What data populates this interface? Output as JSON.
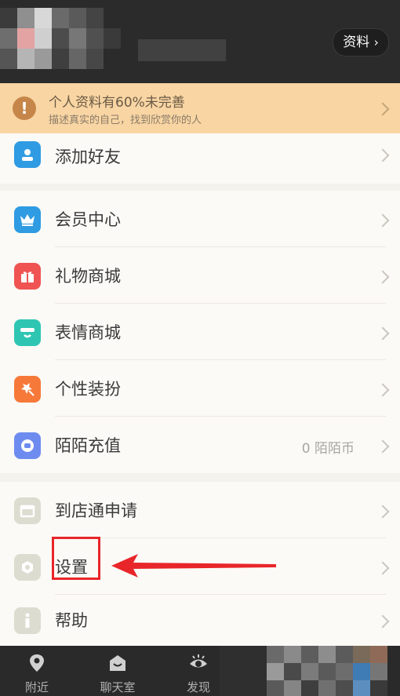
{
  "header": {
    "profile_button": "资料"
  },
  "banner": {
    "title": "个人资料有60%未完善",
    "subtitle": "描述真实的自己，找到欣赏你的人"
  },
  "menu": {
    "add_friend": "添加好友",
    "vip": "会员中心",
    "gift": "礼物商城",
    "emoji": "表情商城",
    "dressup": "个性装扮",
    "recharge": "陌陌充值",
    "recharge_value": "0 陌陌币",
    "store": "到店通申请",
    "settings": "设置",
    "help": "帮助"
  },
  "nav": {
    "nearby": "附近",
    "chatroom": "聊天室",
    "discover": "发现"
  },
  "colors": {
    "add_friend": "#2f9be3",
    "vip": "#2f9be3",
    "gift": "#ef5453",
    "emoji": "#2ec6b2",
    "dressup": "#f7793a",
    "recharge": "#6e8cf0",
    "store": "#dcdcd0",
    "settings": "#dcdcd0",
    "help": "#dcdcd0",
    "annotation": "#e8262a"
  }
}
